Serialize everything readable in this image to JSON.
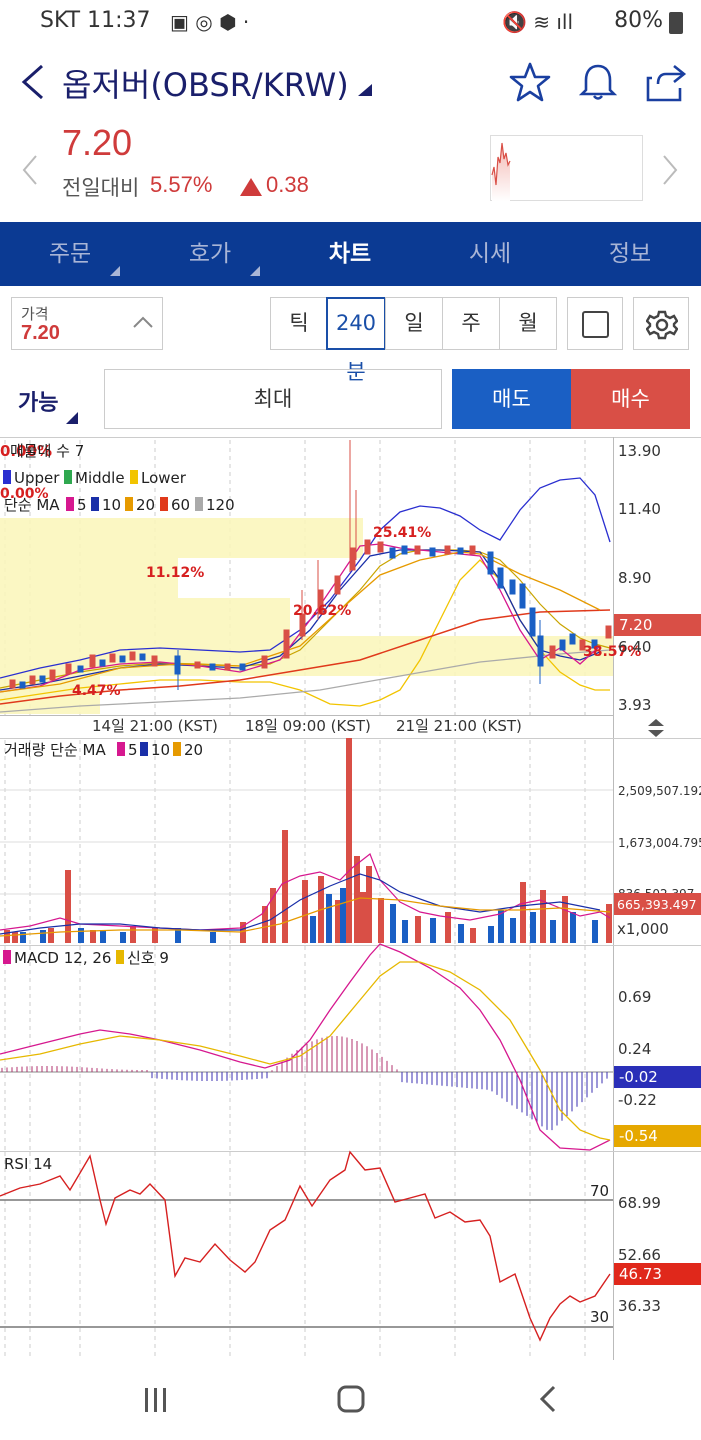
{
  "status": {
    "carrier_time": "SKT 11:37",
    "battery": "80%"
  },
  "header": {
    "title": "옵저버(OBSR/KRW)"
  },
  "price": {
    "current": "7.20",
    "change_label": "전일대비",
    "change_pct": "5.57%",
    "change_abs": "0.38"
  },
  "tabs": [
    {
      "label": "주문"
    },
    {
      "label": "호가"
    },
    {
      "label": "차트"
    },
    {
      "label": "시세"
    },
    {
      "label": "정보"
    }
  ],
  "controls": {
    "price_label": "가격",
    "price_value": "7.20",
    "periods": [
      "틱",
      "240분",
      "일",
      "주",
      "월"
    ],
    "available_label": "가능",
    "max_label": "최대",
    "sell_label": "매도",
    "buy_label": "매수"
  },
  "main_chart": {
    "indicator_line1": "매물대 수 7",
    "pct_top": "0.00%",
    "legend_upper": "Upper",
    "legend_middle": "Middle",
    "legend_lower": "Lower",
    "pct_left": "0.00%",
    "ma_label": "단순 MA",
    "ma_periods": [
      "5",
      "10",
      "20",
      "60",
      "120"
    ],
    "pct_labels": [
      "25.41%",
      "11.12%",
      "20.62%",
      "4.47%",
      "38.57%"
    ],
    "y_ticks": [
      "13.90",
      "11.40",
      "8.90",
      "6.40",
      "3.93"
    ],
    "current_price_tag": "7.20",
    "x_ticks": [
      "14일 21:00 (KST)",
      "18일 09:00 (KST)",
      "21일 21:00 (KST)"
    ],
    "colors": {
      "up": "#d94f46",
      "down": "#1a5fc4",
      "ma5": "#d6188f",
      "ma10": "#1a2fa8",
      "ma20": "#e69a00",
      "ma60": "#e0391b",
      "ma120": "#aaaaaa"
    }
  },
  "volume_chart": {
    "label": "거래량 단순 MA",
    "ma_periods": [
      "5",
      "10",
      "20"
    ],
    "y_ticks": [
      "2,509,507.192",
      "1,673,004.795",
      "836,502.397"
    ],
    "current_tag": "665,393.497",
    "unit": "x1,000"
  },
  "macd_chart": {
    "label": "MACD 12, 26",
    "signal_label": "신호 9",
    "y_ticks": [
      "0.69",
      "0.24",
      "-0.22"
    ],
    "macd_tag": "-0.02",
    "signal_tag": "-0.54"
  },
  "rsi_chart": {
    "label": "RSI 14",
    "level_70": "70",
    "level_30": "30",
    "y_ticks": [
      "68.99",
      "52.66",
      "36.33"
    ],
    "current_tag": "46.73"
  }
}
